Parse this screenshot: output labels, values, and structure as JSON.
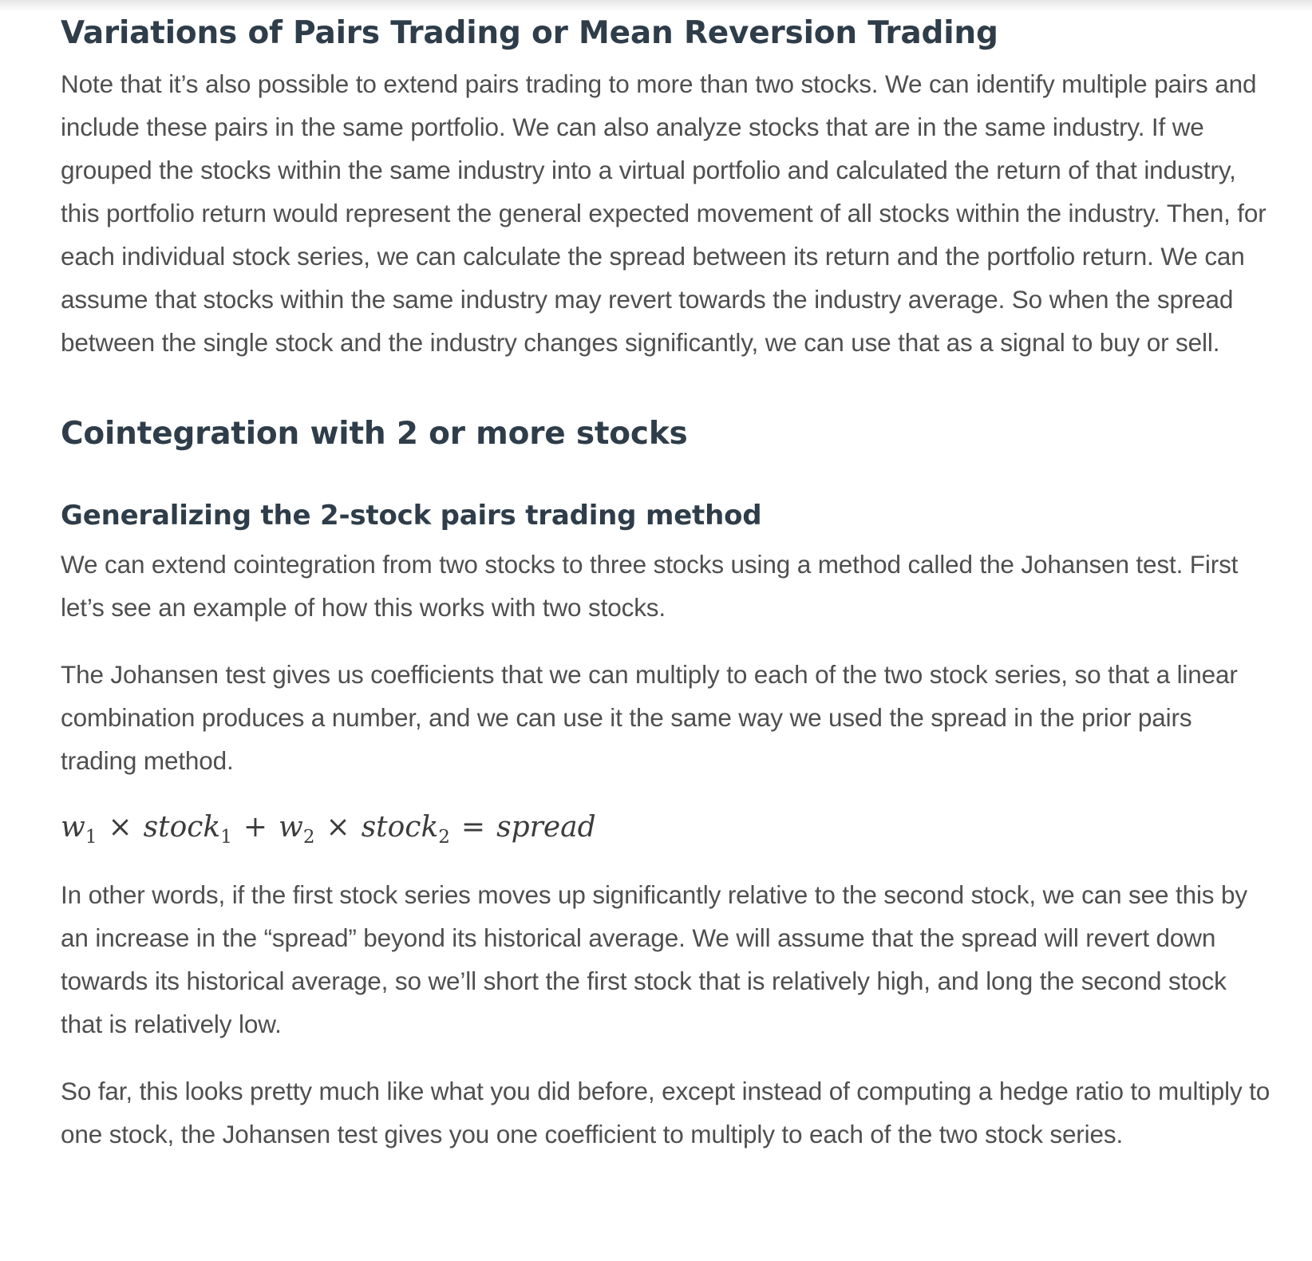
{
  "sections": {
    "variations": {
      "heading": "Variations of Pairs Trading or Mean Reversion Trading",
      "paragraph": "Note that it’s also possible to extend pairs trading to more than two stocks. We can identify multiple pairs and include these pairs in the same portfolio. We can also analyze stocks that are in the same industry. If we grouped the stocks within the same industry into a virtual portfolio and calculated the return of that industry, this portfolio return would represent the general expected movement of all stocks within the industry. Then, for each individual stock series, we can calculate the spread between its return and the portfolio return. We can assume that stocks within the same industry may revert towards the industry average. So when the spread between the single stock and the industry changes significantly, we can use that as a signal to buy or sell."
    },
    "cointegration": {
      "heading": "Cointegration with 2 or more stocks"
    },
    "generalizing": {
      "heading": "Generalizing the 2-stock pairs trading method",
      "p1": "We can extend cointegration from two stocks to three stocks using a method called the Johansen test. First let’s see an example of how this works with two stocks.",
      "p2": "The Johansen test gives us coefficients that we can multiply to each of the two stock series, so that a linear combination produces a number, and we can use it the same way we used the spread in the prior pairs trading method.",
      "formula": {
        "w": "w",
        "sub1": "1",
        "sub2": "2",
        "times": "×",
        "stock": "stock",
        "plus": "+",
        "equals": "=",
        "spread": "spread"
      },
      "p3": "In other words, if the first stock series moves up significantly relative to the second stock, we can see this by an increase in the “spread” beyond its historical average. We will assume that the spread will revert down towards its historical average, so we’ll short the first stock that is relatively high, and long the second stock that is relatively low.",
      "p4": "So far, this looks pretty much like what you did before, except instead of computing a hedge ratio to multiply to one stock, the Johansen test gives you one coefficient to multiply to each of the two stock series."
    }
  }
}
